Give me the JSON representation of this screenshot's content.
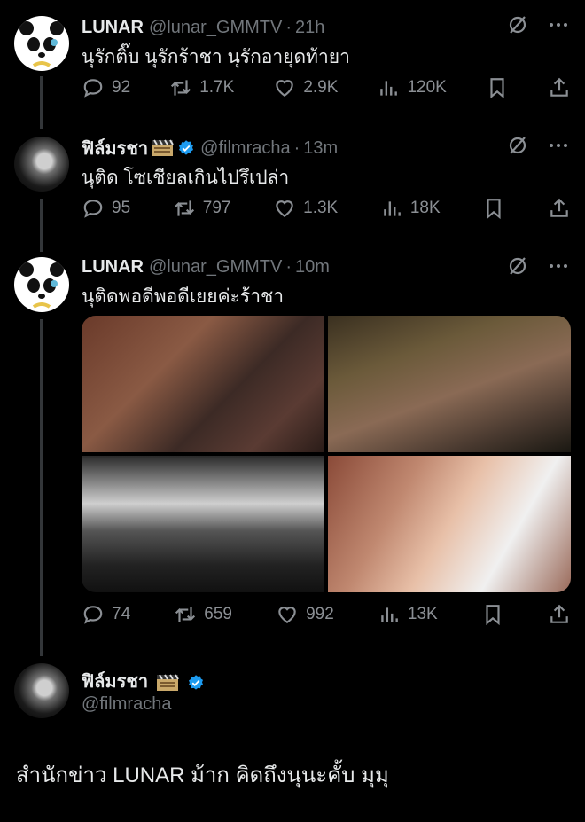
{
  "tweets": [
    {
      "name": "LUNAR",
      "handle": "@lunar_GMMTV",
      "time": "21h",
      "text": "นุรักติ๊บ นุรักร้าชา นุรักอายุดท้ายา",
      "replies": "92",
      "retweets": "1.7K",
      "likes": "2.9K",
      "views": "120K"
    },
    {
      "name": "ฟิล์มรชา",
      "handle": "@filmracha",
      "time": "13m",
      "text": "นุติด โซเชียลเกินไปรึเปล่า",
      "replies": "95",
      "retweets": "797",
      "likes": "1.3K",
      "views": "18K"
    },
    {
      "name": "LUNAR",
      "handle": "@lunar_GMMTV",
      "time": "10m",
      "text": "นุติดพอดีพอดีเยยค่ะร้าชา",
      "replies": "74",
      "retweets": "659",
      "likes": "992",
      "views": "13K"
    }
  ],
  "main_tweet": {
    "name": "ฟิล์มรชา",
    "handle": "@filmracha",
    "text": "สำนักข่าว LUNAR ม้าก คิดถึงนุนะคั้บ มุมุ"
  },
  "separator": "·",
  "icons": {
    "more": "more-horizontal-icon",
    "mute": "grok-slash-icon",
    "reply": "reply-icon",
    "retweet": "retweet-icon",
    "like": "heart-icon",
    "views": "views-chart-icon",
    "bookmark": "bookmark-icon",
    "share": "share-icon",
    "verified": "verified-badge-icon",
    "clapper": "clapperboard-emoji"
  },
  "colors": {
    "background": "#000000",
    "text_primary": "#e7e9ea",
    "text_secondary": "#71767b",
    "verified": "#1d9bf0"
  }
}
